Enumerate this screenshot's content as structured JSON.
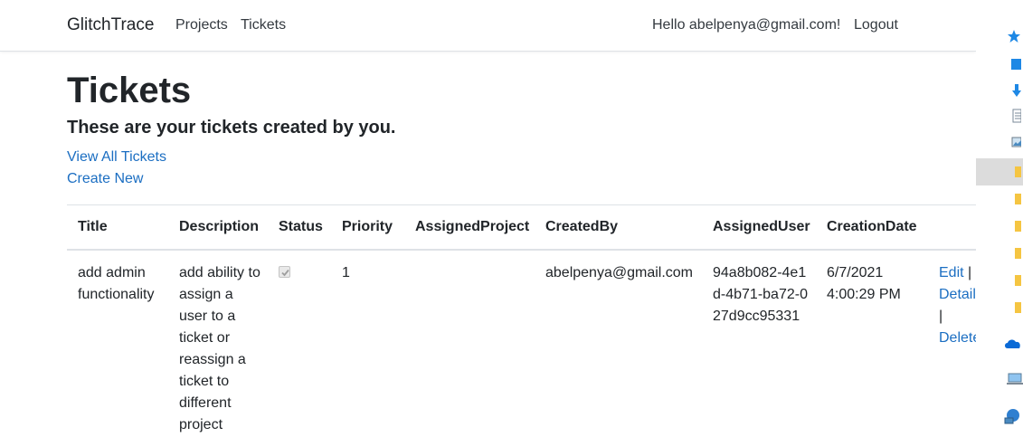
{
  "navbar": {
    "brand": "GlitchTrace",
    "links": [
      "Projects",
      "Tickets"
    ],
    "greeting": "Hello abelpenya@gmail.com!",
    "logout": "Logout"
  },
  "page": {
    "title": "Tickets",
    "subtitle": "These are your tickets created by you.",
    "view_all": "View All Tickets",
    "create_new": "Create New"
  },
  "table": {
    "headers": [
      "Title",
      "Description",
      "Status",
      "Priority",
      "AssignedProject",
      "CreatedBy",
      "AssignedUser",
      "CreationDate"
    ],
    "rows": [
      {
        "title": "add admin functionality",
        "description": "add ability to assign a user to a ticket or reassign a ticket to different project",
        "status_checked": true,
        "priority": "1",
        "assigned_project": "",
        "created_by": "abelpenya@gmail.com",
        "assigned_user": "94a8b082-4e1d-4b71-ba72-027d9cc95331",
        "creation_date": "6/7/2021 4:00:29 PM",
        "actions": {
          "edit": "Edit",
          "sep1": "|",
          "details": "Details",
          "sep2": "|",
          "delete": "Delete"
        }
      }
    ]
  },
  "sidebar": {
    "icons": [
      "star-icon",
      "square-icon",
      "download-icon",
      "document-icon",
      "image-icon",
      "folder-icon",
      "folder-icon",
      "folder-icon",
      "folder-icon",
      "folder-icon",
      "folder-icon",
      "cloud-icon",
      "computer-icon",
      "network-icon"
    ],
    "colors": {
      "blue": "#1e88e5",
      "folder": "#f5c542",
      "selected": "#dcdcdc"
    }
  },
  "colors": {
    "link": "#1b6ec2",
    "text": "#212529",
    "border": "#dee2e6"
  }
}
